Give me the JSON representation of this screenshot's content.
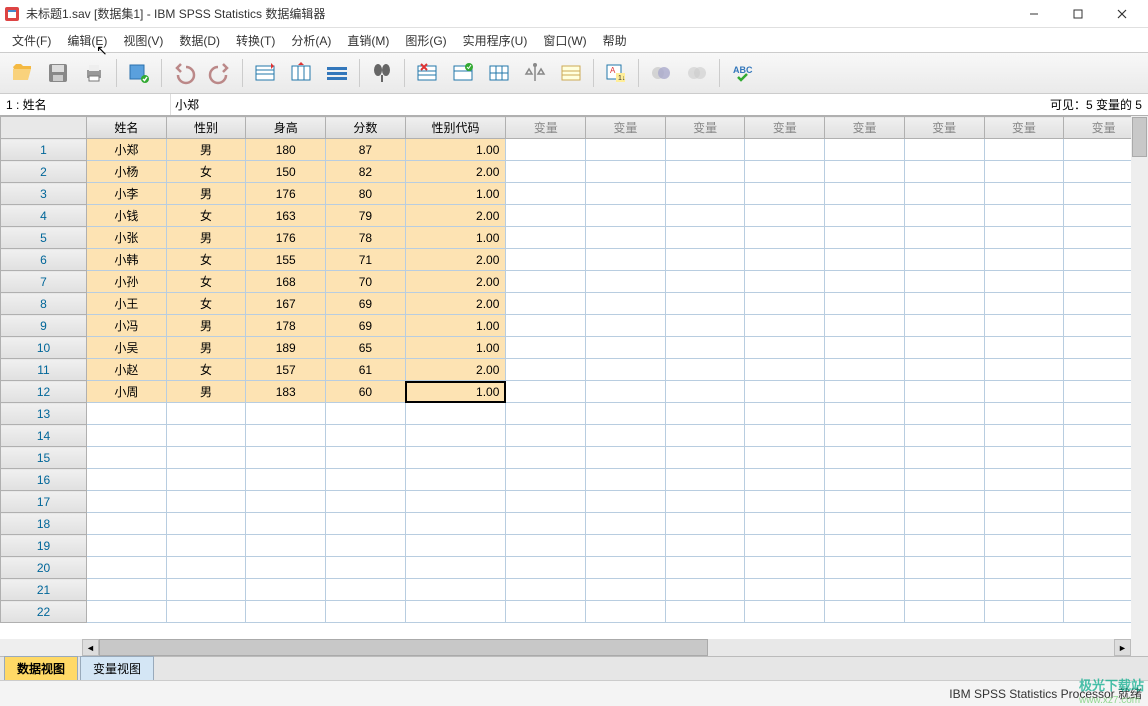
{
  "window": {
    "title": "未标题1.sav [数据集1] - IBM SPSS Statistics 数据编辑器"
  },
  "menu": {
    "items": [
      "文件(F)",
      "编辑(E)",
      "视图(V)",
      "数据(D)",
      "转换(T)",
      "分析(A)",
      "直销(M)",
      "图形(G)",
      "实用程序(U)",
      "窗口(W)",
      "帮助"
    ]
  },
  "infobar": {
    "cell_ref": "1 : 姓名",
    "cell_value": "小郑",
    "visible": "可见：5 变量的 5"
  },
  "columns": {
    "data": [
      "姓名",
      "性别",
      "身高",
      "分数",
      "性别代码"
    ],
    "empty_label": "变量",
    "empty_count": 8
  },
  "rows": [
    {
      "n": "1",
      "name": "小郑",
      "sex": "男",
      "height": "180",
      "score": "87",
      "code": "1.00"
    },
    {
      "n": "2",
      "name": "小杨",
      "sex": "女",
      "height": "150",
      "score": "82",
      "code": "2.00"
    },
    {
      "n": "3",
      "name": "小李",
      "sex": "男",
      "height": "176",
      "score": "80",
      "code": "1.00"
    },
    {
      "n": "4",
      "name": "小钱",
      "sex": "女",
      "height": "163",
      "score": "79",
      "code": "2.00"
    },
    {
      "n": "5",
      "name": "小张",
      "sex": "男",
      "height": "176",
      "score": "78",
      "code": "1.00"
    },
    {
      "n": "6",
      "name": "小韩",
      "sex": "女",
      "height": "155",
      "score": "71",
      "code": "2.00"
    },
    {
      "n": "7",
      "name": "小孙",
      "sex": "女",
      "height": "168",
      "score": "70",
      "code": "2.00"
    },
    {
      "n": "8",
      "name": "小王",
      "sex": "女",
      "height": "167",
      "score": "69",
      "code": "2.00"
    },
    {
      "n": "9",
      "name": "小冯",
      "sex": "男",
      "height": "178",
      "score": "69",
      "code": "1.00"
    },
    {
      "n": "10",
      "name": "小吴",
      "sex": "男",
      "height": "189",
      "score": "65",
      "code": "1.00"
    },
    {
      "n": "11",
      "name": "小赵",
      "sex": "女",
      "height": "157",
      "score": "61",
      "code": "2.00"
    },
    {
      "n": "12",
      "name": "小周",
      "sex": "男",
      "height": "183",
      "score": "60",
      "code": "1.00"
    }
  ],
  "empty_rows": [
    "13",
    "14",
    "15",
    "16",
    "17",
    "18",
    "19",
    "20",
    "21",
    "22"
  ],
  "selected_cell": {
    "row": 12,
    "col": "code"
  },
  "tabs": {
    "data_view": "数据视图",
    "variable_view": "变量视图"
  },
  "status": {
    "processor": "IBM SPSS Statistics Processor 就绪"
  },
  "watermark": {
    "logo": "极光下载站",
    "url": "www.xz7.com"
  }
}
